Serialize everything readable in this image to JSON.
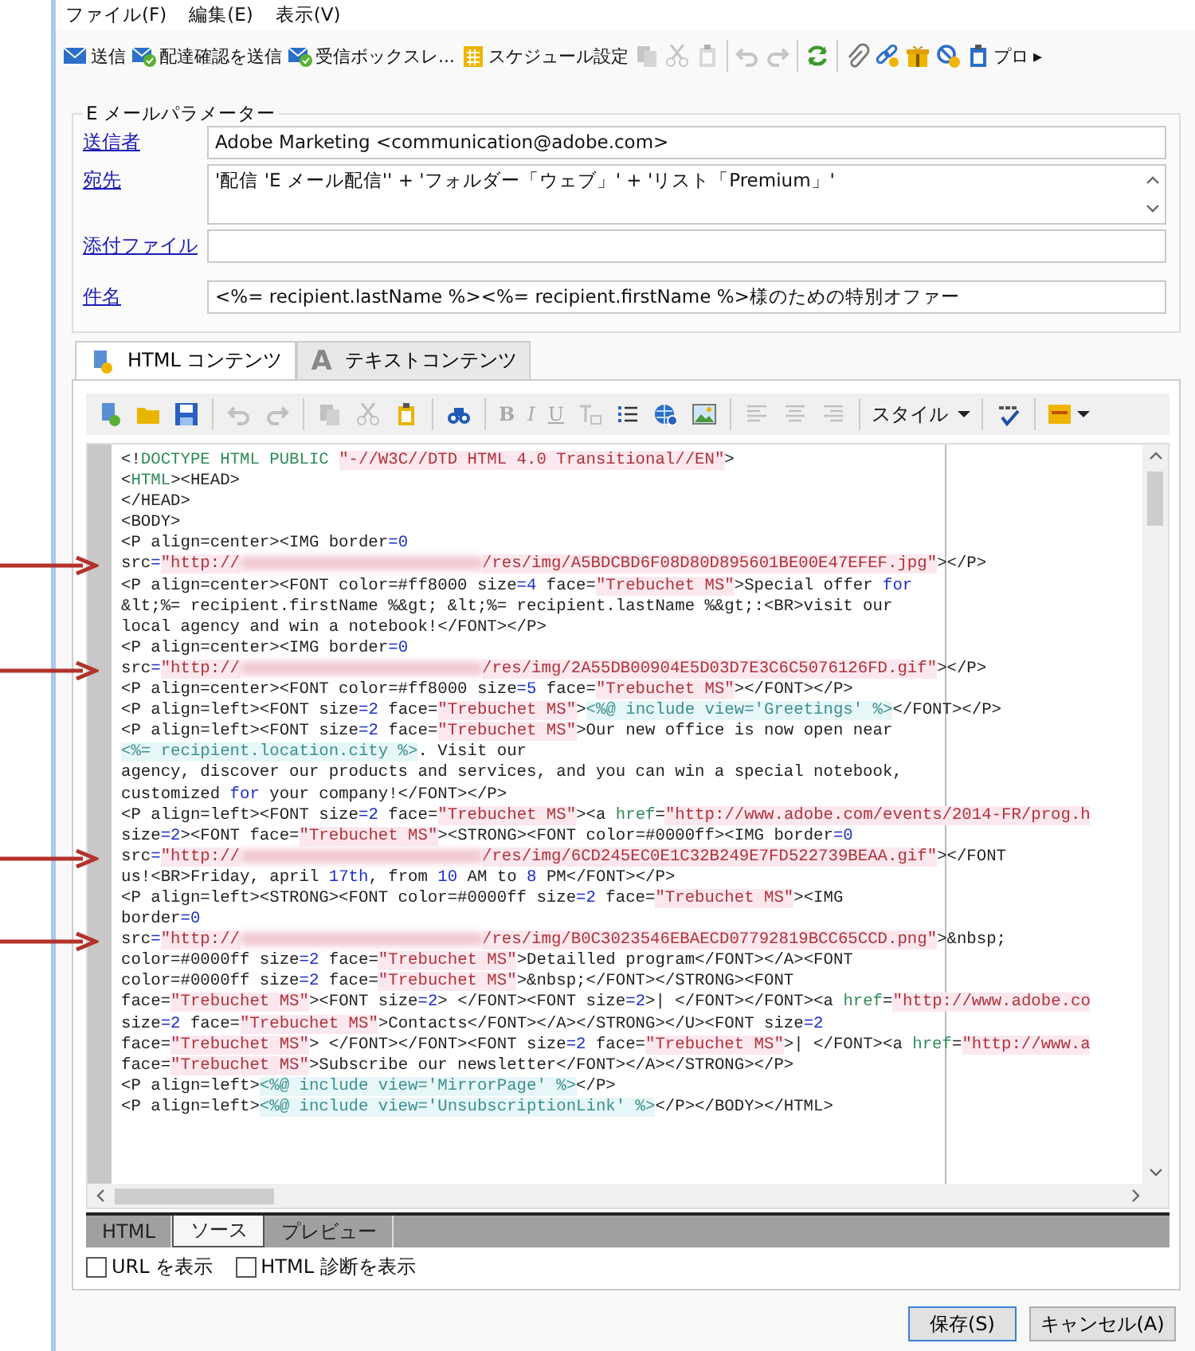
{
  "menu": [
    "ファイル(F)",
    "編集(E)",
    "表示(V)"
  ],
  "toolbar": [
    {
      "kind": "button",
      "label": "送信",
      "disabled": false
    },
    {
      "kind": "button",
      "label": "配達確認を送信",
      "disabled": false
    },
    {
      "kind": "button",
      "label": "受信ボックスレ...",
      "disabled": false
    },
    {
      "kind": "button",
      "label": "スケジュール設定",
      "disabled": false
    },
    {
      "kind": "button",
      "disabled": true
    },
    {
      "kind": "button",
      "disabled": true
    },
    {
      "kind": "button",
      "disabled": true
    },
    {
      "kind": "separator"
    },
    {
      "kind": "button",
      "disabled": true
    },
    {
      "kind": "button",
      "disabled": true
    },
    {
      "kind": "separator"
    },
    {
      "kind": "button",
      "disabled": false
    },
    {
      "kind": "separator"
    },
    {
      "kind": "button",
      "disabled": false
    },
    {
      "kind": "button",
      "disabled": false
    },
    {
      "kind": "button",
      "disabled": false
    },
    {
      "kind": "button",
      "disabled": false
    },
    {
      "kind": "button",
      "label": "プロ",
      "disabled": false
    },
    {
      "kind": "overflow",
      "label": "▸"
    }
  ],
  "parameters": {
    "title": "E メールパラメーター",
    "fields": [
      {
        "label": "送信者",
        "value": "Adobe Marketing  <communication@adobe.com>",
        "kind": "single"
      },
      {
        "label": "宛先",
        "value": "'配信 'E メール配信'' + 'フォルダー「ウェブ」' + 'リスト「Premium」'",
        "kind": "multi"
      },
      {
        "label": "添付ファイル",
        "kind": "single"
      },
      {
        "label": "件名",
        "value": "<%= recipient.lastName %><%= recipient.firstName %>様のための特別オファー",
        "kind": "single"
      }
    ]
  },
  "content_tabs": [
    {
      "label": "HTML コンテンツ",
      "selected": true
    },
    {
      "label": "テキストコンテンツ",
      "icon_char": "A",
      "selected": false
    }
  ],
  "editor_toolbar": [
    {
      "kind": "button",
      "disabled": false
    },
    {
      "kind": "button",
      "disabled": false
    },
    {
      "kind": "button",
      "disabled": false
    },
    {
      "kind": "separator"
    },
    {
      "kind": "button",
      "disabled": true
    },
    {
      "kind": "button",
      "disabled": true
    },
    {
      "kind": "separator"
    },
    {
      "kind": "button",
      "disabled": true
    },
    {
      "kind": "button",
      "disabled": true
    },
    {
      "kind": "button",
      "disabled": false
    },
    {
      "kind": "separator"
    },
    {
      "kind": "button",
      "disabled": false
    },
    {
      "kind": "separator"
    },
    {
      "kind": "button",
      "label": "B",
      "disabled": true
    },
    {
      "kind": "button",
      "label": "I",
      "disabled": true
    },
    {
      "kind": "button",
      "label": "U",
      "disabled": true
    },
    {
      "kind": "button",
      "disabled": true
    },
    {
      "kind": "button",
      "disabled": false
    },
    {
      "kind": "button",
      "disabled": false
    },
    {
      "kind": "button",
      "disabled": false
    },
    {
      "kind": "separator"
    },
    {
      "kind": "button",
      "disabled": true
    },
    {
      "kind": "button",
      "disabled": true
    },
    {
      "kind": "button",
      "disabled": true
    },
    {
      "kind": "separator"
    },
    {
      "kind": "dropdown",
      "label": "スタイル"
    },
    {
      "kind": "separator"
    },
    {
      "kind": "button",
      "disabled": false
    },
    {
      "kind": "separator"
    },
    {
      "kind": "dropdown"
    }
  ],
  "code_lines": [
    {
      "marked": false,
      "segments": [
        {
          "kind": "t",
          "text": "<!"
        },
        {
          "kind": "d",
          "text": "DOCTYPE HTML PUBLIC "
        },
        {
          "kind": "s",
          "text": "\"-//W3C//DTD HTML 4.0 Transitional//EN\""
        },
        {
          "kind": "t",
          "text": ">"
        }
      ]
    },
    {
      "marked": false,
      "segments": [
        {
          "kind": "t",
          "text": "<"
        },
        {
          "kind": "d",
          "text": "HTML"
        },
        {
          "kind": "t",
          "text": "><HEAD>"
        }
      ]
    },
    {
      "marked": false,
      "segments": [
        {
          "kind": "t",
          "text": "</HEAD>"
        }
      ]
    },
    {
      "marked": false,
      "segments": [
        {
          "kind": "t",
          "text": "<BODY>"
        }
      ]
    },
    {
      "marked": false,
      "segments": [
        {
          "kind": "t",
          "text": "<P align=center><IMG border"
        },
        {
          "kind": "n",
          "text": "=0"
        }
      ]
    },
    {
      "marked": true,
      "segments": [
        {
          "kind": "t",
          "text": "src"
        },
        {
          "kind": "n",
          "text": "="
        },
        {
          "kind": "s",
          "text": "\"http://"
        },
        {
          "kind": "blur"
        },
        {
          "kind": "s",
          "text": "/res/img/A5BDCBD6F08D80D895601BE00E47EFEF.jpg\""
        },
        {
          "kind": "t",
          "text": "></P>"
        }
      ]
    },
    {
      "marked": false,
      "segments": [
        {
          "kind": "t",
          "text": "<P align=center><FONT color=#ff8000 size"
        },
        {
          "kind": "n",
          "text": "=4"
        },
        {
          "kind": "t",
          "text": " face="
        },
        {
          "kind": "s",
          "text": "\"Trebuchet MS\""
        },
        {
          "kind": "t",
          "text": ">Special offer "
        },
        {
          "kind": "n",
          "text": "for"
        }
      ]
    },
    {
      "marked": false,
      "segments": [
        {
          "kind": "t",
          "text": "&lt;%= recipient.firstName %&gt; &lt;%= recipient.lastName %&gt;:<BR>visit our"
        }
      ]
    },
    {
      "marked": false,
      "segments": [
        {
          "kind": "t",
          "text": "local agency and win a notebook!</FONT></P>"
        }
      ]
    },
    {
      "marked": false,
      "segments": [
        {
          "kind": "t",
          "text": "<P align=center><IMG border"
        },
        {
          "kind": "n",
          "text": "=0"
        }
      ]
    },
    {
      "marked": true,
      "segments": [
        {
          "kind": "t",
          "text": "src"
        },
        {
          "kind": "n",
          "text": "="
        },
        {
          "kind": "s",
          "text": "\"http://"
        },
        {
          "kind": "blur"
        },
        {
          "kind": "s",
          "text": "/res/img/2A55DB00904E5D03D7E3C6C5076126FD.gif\""
        },
        {
          "kind": "t",
          "text": "></P>"
        }
      ]
    },
    {
      "marked": false,
      "segments": [
        {
          "kind": "t",
          "text": "<P align=center><FONT color=#ff8000 size"
        },
        {
          "kind": "n",
          "text": "=5"
        },
        {
          "kind": "t",
          "text": " face="
        },
        {
          "kind": "s",
          "text": "\"Trebuchet MS\""
        },
        {
          "kind": "t",
          "text": "></FONT></P>"
        }
      ]
    },
    {
      "marked": false,
      "segments": [
        {
          "kind": "t",
          "text": "<P align=left><FONT size"
        },
        {
          "kind": "n",
          "text": "=2"
        },
        {
          "kind": "t",
          "text": " face="
        },
        {
          "kind": "s",
          "text": "\"Trebuchet MS\""
        },
        {
          "kind": "t",
          "text": ">"
        },
        {
          "kind": "g",
          "text": "<%@ include view='Greetings' %>"
        },
        {
          "kind": "t",
          "text": "</FONT></P>"
        }
      ]
    },
    {
      "marked": false,
      "segments": [
        {
          "kind": "t",
          "text": "<P align=left><FONT size"
        },
        {
          "kind": "n",
          "text": "=2"
        },
        {
          "kind": "t",
          "text": " face="
        },
        {
          "kind": "s",
          "text": "\"Trebuchet MS\""
        },
        {
          "kind": "t",
          "text": ">Our new office is now open near"
        }
      ]
    },
    {
      "marked": false,
      "segments": [
        {
          "kind": "g",
          "text": "<%= recipient.location.city %>"
        },
        {
          "kind": "t",
          "text": ". Visit our"
        }
      ]
    },
    {
      "marked": false,
      "segments": [
        {
          "kind": "t",
          "text": "agency, discover our products and services, and you can win a special notebook,"
        }
      ]
    },
    {
      "marked": false,
      "segments": [
        {
          "kind": "t",
          "text": "customized "
        },
        {
          "kind": "n",
          "text": "for"
        },
        {
          "kind": "t",
          "text": " your company!</FONT></P>"
        }
      ]
    },
    {
      "marked": false,
      "segments": [
        {
          "kind": "t",
          "text": "<P align=left><FONT size"
        },
        {
          "kind": "n",
          "text": "=2"
        },
        {
          "kind": "t",
          "text": " face="
        },
        {
          "kind": "s",
          "text": "\"Trebuchet MS\""
        },
        {
          "kind": "t",
          "text": "><a "
        },
        {
          "kind": "d",
          "text": "href"
        },
        {
          "kind": "t",
          "text": "="
        },
        {
          "kind": "s",
          "text": "\"http://www.adobe.com/events/2014-FR/prog.h"
        }
      ]
    },
    {
      "marked": false,
      "segments": [
        {
          "kind": "t",
          "text": "size"
        },
        {
          "kind": "n",
          "text": "=2"
        },
        {
          "kind": "t",
          "text": "><FONT face="
        },
        {
          "kind": "s",
          "text": "\"Trebuchet MS\""
        },
        {
          "kind": "t",
          "text": "><STRONG><FONT color=#0000ff><IMG border"
        },
        {
          "kind": "n",
          "text": "=0"
        }
      ]
    },
    {
      "marked": true,
      "segments": [
        {
          "kind": "t",
          "text": "src"
        },
        {
          "kind": "n",
          "text": "="
        },
        {
          "kind": "s",
          "text": "\"http://"
        },
        {
          "kind": "blur"
        },
        {
          "kind": "s",
          "text": "/res/img/6CD245EC0E1C32B249E7FD522739BEAA.gif\""
        },
        {
          "kind": "t",
          "text": "></FONT"
        }
      ]
    },
    {
      "marked": false,
      "segments": [
        {
          "kind": "t",
          "text": "us!<BR>Friday, april "
        },
        {
          "kind": "n",
          "text": "17th"
        },
        {
          "kind": "t",
          "text": ", from "
        },
        {
          "kind": "n",
          "text": "10"
        },
        {
          "kind": "t",
          "text": " AM to "
        },
        {
          "kind": "n",
          "text": "8"
        },
        {
          "kind": "t",
          "text": " PM</FONT></P>"
        }
      ]
    },
    {
      "marked": false,
      "segments": [
        {
          "kind": "t",
          "text": "<P align=left><STRONG><FONT color=#0000ff size"
        },
        {
          "kind": "n",
          "text": "=2"
        },
        {
          "kind": "t",
          "text": " face="
        },
        {
          "kind": "s",
          "text": "\"Trebuchet MS\""
        },
        {
          "kind": "t",
          "text": "><IMG"
        }
      ]
    },
    {
      "marked": false,
      "segments": [
        {
          "kind": "t",
          "text": "border"
        },
        {
          "kind": "n",
          "text": "=0"
        }
      ]
    },
    {
      "marked": true,
      "segments": [
        {
          "kind": "t",
          "text": "src"
        },
        {
          "kind": "n",
          "text": "="
        },
        {
          "kind": "s",
          "text": "\"http://"
        },
        {
          "kind": "blur"
        },
        {
          "kind": "s",
          "text": "/res/img/B0C3023546EBAECD07792819BCC65CCD.png\""
        },
        {
          "kind": "t",
          "text": ">&nbsp;"
        }
      ]
    },
    {
      "marked": false,
      "segments": [
        {
          "kind": "t",
          "text": "color=#0000ff size"
        },
        {
          "kind": "n",
          "text": "=2"
        },
        {
          "kind": "t",
          "text": " face="
        },
        {
          "kind": "s",
          "text": "\"Trebuchet MS\""
        },
        {
          "kind": "t",
          "text": ">Detailled program</FONT></A><FONT"
        }
      ]
    },
    {
      "marked": false,
      "segments": [
        {
          "kind": "t",
          "text": "color=#0000ff size"
        },
        {
          "kind": "n",
          "text": "=2"
        },
        {
          "kind": "t",
          "text": " face="
        },
        {
          "kind": "s",
          "text": "\"Trebuchet MS\""
        },
        {
          "kind": "t",
          "text": ">&nbsp;</FONT></STRONG><FONT"
        }
      ]
    },
    {
      "marked": false,
      "segments": [
        {
          "kind": "t",
          "text": "face="
        },
        {
          "kind": "s",
          "text": "\"Trebuchet MS\""
        },
        {
          "kind": "t",
          "text": "><FONT size"
        },
        {
          "kind": "n",
          "text": "=2"
        },
        {
          "kind": "t",
          "text": "> </FONT><FONT size"
        },
        {
          "kind": "n",
          "text": "=2"
        },
        {
          "kind": "t",
          "text": ">| </FONT></FONT><a "
        },
        {
          "kind": "d",
          "text": "href"
        },
        {
          "kind": "t",
          "text": "="
        },
        {
          "kind": "s",
          "text": "\"http://www.adobe.co"
        }
      ]
    },
    {
      "marked": false,
      "segments": [
        {
          "kind": "t",
          "text": "size"
        },
        {
          "kind": "n",
          "text": "=2"
        },
        {
          "kind": "t",
          "text": " face="
        },
        {
          "kind": "s",
          "text": "\"Trebuchet MS\""
        },
        {
          "kind": "t",
          "text": ">Contacts</FONT></A></STRONG></U><FONT size"
        },
        {
          "kind": "n",
          "text": "=2"
        }
      ]
    },
    {
      "marked": false,
      "segments": [
        {
          "kind": "t",
          "text": "face="
        },
        {
          "kind": "s",
          "text": "\"Trebuchet MS\""
        },
        {
          "kind": "t",
          "text": "> </FONT></FONT><FONT size"
        },
        {
          "kind": "n",
          "text": "=2"
        },
        {
          "kind": "t",
          "text": " face="
        },
        {
          "kind": "s",
          "text": "\"Trebuchet MS\""
        },
        {
          "kind": "t",
          "text": ">| </FONT><a "
        },
        {
          "kind": "d",
          "text": "href"
        },
        {
          "kind": "t",
          "text": "="
        },
        {
          "kind": "s",
          "text": "\"http://www.a"
        }
      ]
    },
    {
      "marked": false,
      "segments": [
        {
          "kind": "t",
          "text": "face="
        },
        {
          "kind": "s",
          "text": "\"Trebuchet MS\""
        },
        {
          "kind": "t",
          "text": ">Subscribe our newsletter</FONT></A></STRONG></P>"
        }
      ]
    },
    {
      "marked": false,
      "segments": [
        {
          "kind": "t",
          "text": "<P align=left>"
        },
        {
          "kind": "g",
          "text": "<%@ include view='MirrorPage' %>"
        },
        {
          "kind": "t",
          "text": "</P>"
        }
      ]
    },
    {
      "marked": false,
      "segments": [
        {
          "kind": "t",
          "text": "<P align=left>"
        },
        {
          "kind": "g",
          "text": "<%@ include view='UnsubscriptionLink' %>"
        },
        {
          "kind": "t",
          "text": "</P></BODY></HTML>"
        }
      ]
    }
  ],
  "view_tabs": [
    {
      "label": "HTML",
      "selected": false
    },
    {
      "label": "ソース",
      "selected": true
    },
    {
      "label": "プレビュー",
      "selected": false
    }
  ],
  "options": [
    {
      "label": "URL を表示",
      "checked": false
    },
    {
      "label": "HTML 診断を表示",
      "checked": false
    }
  ],
  "buttons": [
    {
      "label": "保存(S)",
      "default": true
    },
    {
      "label": "キャンセル(A)",
      "default": false
    }
  ]
}
